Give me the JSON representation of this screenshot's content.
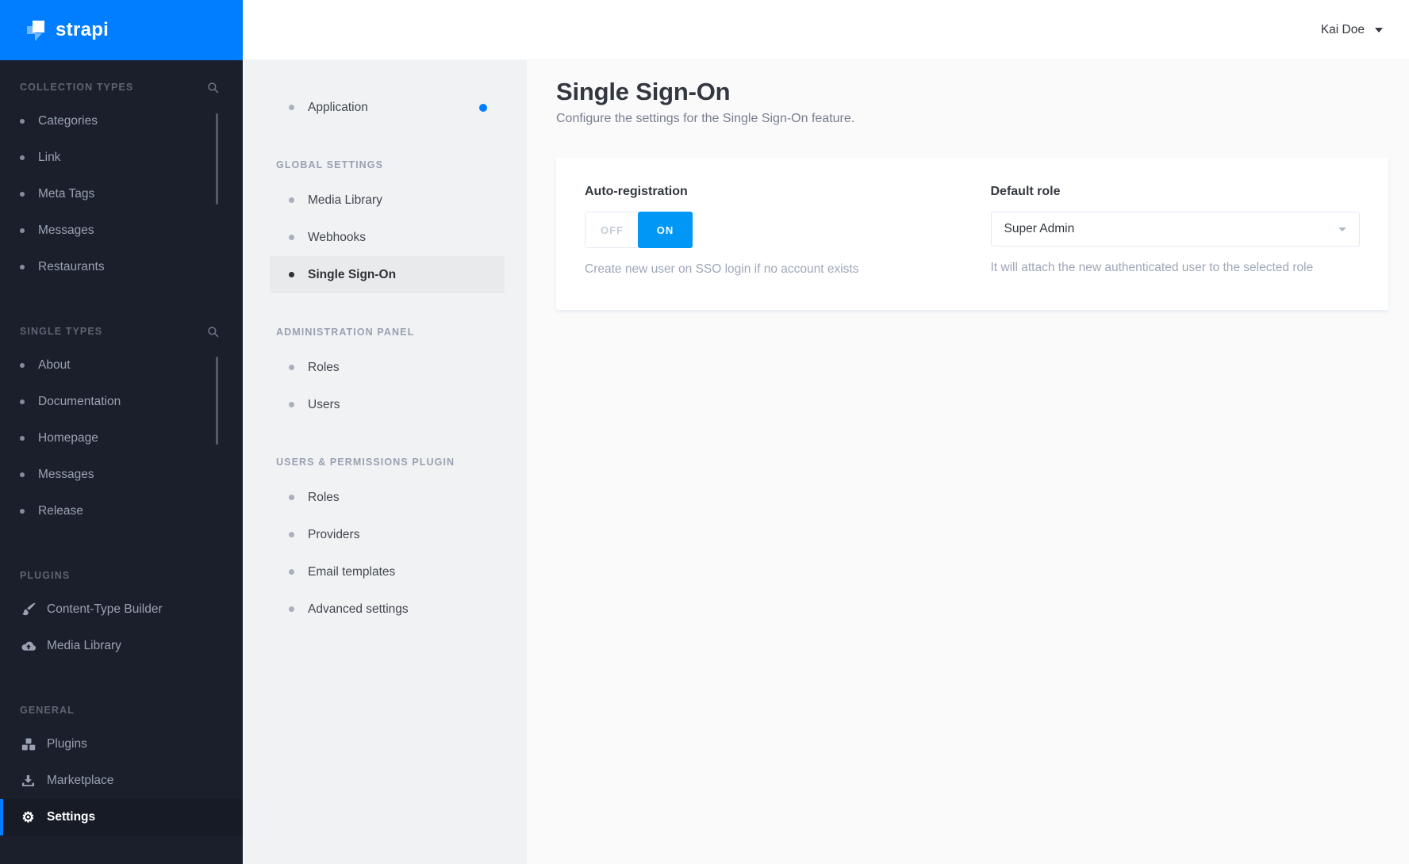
{
  "brand": {
    "name": "strapi"
  },
  "topbar": {
    "user_name": "Kai Doe"
  },
  "left_menu": {
    "sections": [
      {
        "label": "COLLECTION TYPES",
        "has_search": true,
        "scrollbar": true,
        "items": [
          {
            "label": "Categories"
          },
          {
            "label": "Link"
          },
          {
            "label": "Meta Tags"
          },
          {
            "label": "Messages"
          },
          {
            "label": "Restaurants"
          }
        ]
      },
      {
        "label": "SINGLE TYPES",
        "has_search": true,
        "scrollbar": true,
        "items": [
          {
            "label": "About"
          },
          {
            "label": "Documentation"
          },
          {
            "label": "Homepage"
          },
          {
            "label": "Messages"
          },
          {
            "label": "Release"
          }
        ]
      },
      {
        "label": "PLUGINS",
        "items": [
          {
            "label": "Content-Type Builder",
            "icon": "paint-brush-icon"
          },
          {
            "label": "Media Library",
            "icon": "cloud-upload-icon"
          }
        ]
      },
      {
        "label": "GENERAL",
        "items": [
          {
            "label": "Plugins",
            "icon": "cubes-icon"
          },
          {
            "label": "Marketplace",
            "icon": "download-icon"
          },
          {
            "label": "Settings",
            "icon": "gear-icon",
            "active": true
          }
        ]
      }
    ]
  },
  "settings_menu": {
    "top_items": [
      {
        "label": "Application",
        "notification": true
      }
    ],
    "sections": [
      {
        "label": "GLOBAL SETTINGS",
        "items": [
          {
            "label": "Media Library"
          },
          {
            "label": "Webhooks"
          },
          {
            "label": "Single Sign-On",
            "active": true
          }
        ]
      },
      {
        "label": "ADMINISTRATION PANEL",
        "items": [
          {
            "label": "Roles"
          },
          {
            "label": "Users"
          }
        ]
      },
      {
        "label": "USERS & PERMISSIONS PLUGIN",
        "items": [
          {
            "label": "Roles"
          },
          {
            "label": "Providers"
          },
          {
            "label": "Email templates"
          },
          {
            "label": "Advanced settings"
          }
        ]
      }
    ]
  },
  "page": {
    "title": "Single Sign-On",
    "subtitle": "Configure the settings for the Single Sign-On feature.",
    "card": {
      "auto_registration": {
        "label": "Auto-registration",
        "off_label": "OFF",
        "on_label": "ON",
        "value": "ON",
        "helper": "Create new user on SSO login if no account exists"
      },
      "default_role": {
        "label": "Default role",
        "value": "Super Admin",
        "helper": "It will attach the new authenticated user to the selected role"
      }
    }
  },
  "colors": {
    "brand_blue": "#007eff",
    "toggle_on_blue": "#0097f7",
    "sidebar_dark": "#1a1f2b",
    "subnav_bg": "#f0f2f4",
    "active_item_bg": "#e9eaeb"
  }
}
